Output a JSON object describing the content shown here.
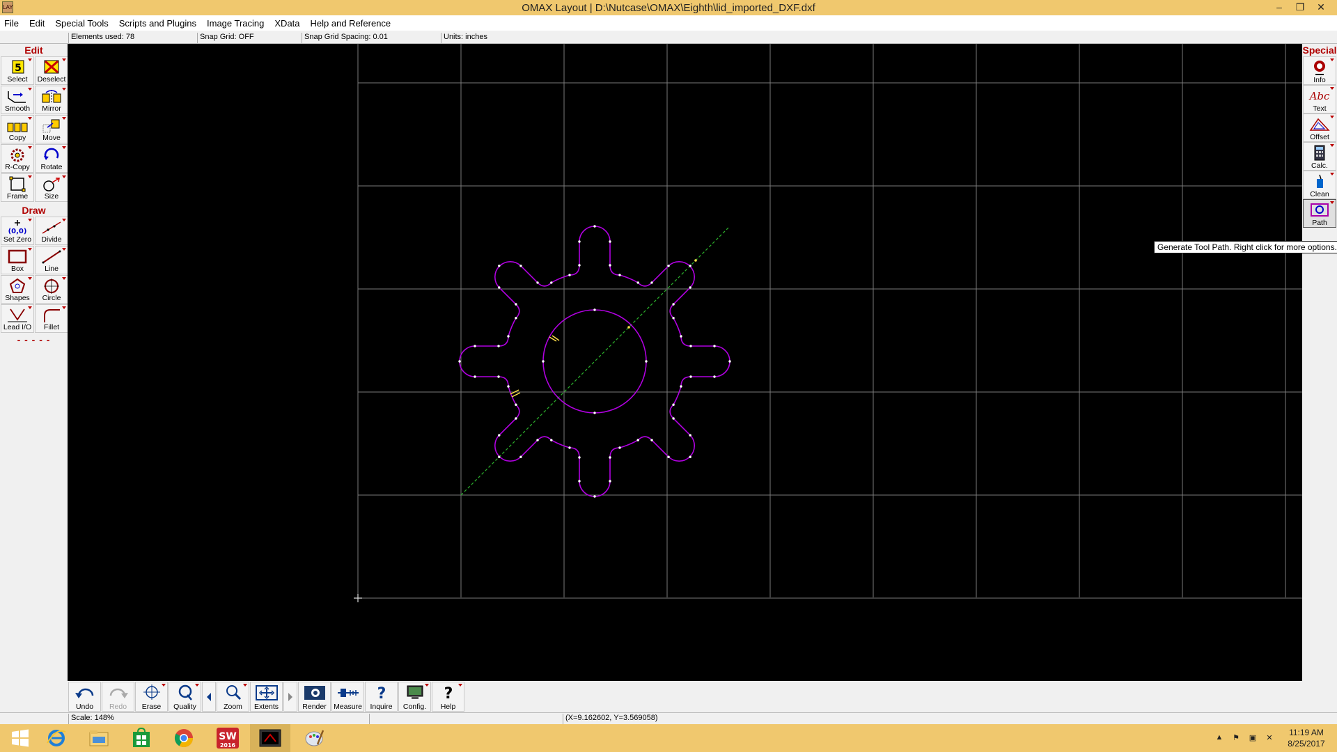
{
  "window": {
    "title": "OMAX Layout | D:\\Nutcase\\OMAX\\Eighth\\lid_imported_DXF.dxf",
    "app_icon_text": "LAY",
    "controls": [
      "–",
      "❐",
      "✕"
    ]
  },
  "menu": [
    "File",
    "Edit",
    "Special Tools",
    "Scripts and Plugins",
    "Image Tracing",
    "XData",
    "Help and Reference"
  ],
  "status_top": {
    "elements_used": "Elements used: 78",
    "snap_grid": "Snap Grid: OFF",
    "snap_spacing": "Snap Grid Spacing: 0.01",
    "units": "Units: inches"
  },
  "left_toolbar": {
    "edit_heading": "Edit",
    "draw_heading": "Draw",
    "more": "- - - - -",
    "edit_tools": [
      {
        "label": "Select",
        "icon": "select-icon"
      },
      {
        "label": "Deselect",
        "icon": "deselect-icon"
      },
      {
        "label": "Smooth",
        "icon": "smooth-icon"
      },
      {
        "label": "Mirror",
        "icon": "mirror-icon"
      },
      {
        "label": "Copy",
        "icon": "copy-icon"
      },
      {
        "label": "Move",
        "icon": "move-icon"
      },
      {
        "label": "R-Copy",
        "icon": "rotary-copy-icon"
      },
      {
        "label": "Rotate",
        "icon": "rotate-icon"
      },
      {
        "label": "Frame",
        "icon": "frame-icon"
      },
      {
        "label": "Size",
        "icon": "size-icon"
      }
    ],
    "draw_tools": [
      {
        "label": "Set Zero",
        "icon": "set-zero-icon"
      },
      {
        "label": "Divide",
        "icon": "divide-icon"
      },
      {
        "label": "Box",
        "icon": "box-icon"
      },
      {
        "label": "Line",
        "icon": "line-icon"
      },
      {
        "label": "Shapes",
        "icon": "shapes-icon"
      },
      {
        "label": "Circle",
        "icon": "circle-icon"
      },
      {
        "label": "Lead I/O",
        "icon": "lead-io-icon"
      },
      {
        "label": "Fillet",
        "icon": "fillet-icon"
      }
    ]
  },
  "right_toolbar": {
    "heading": "Special",
    "tools": [
      {
        "label": "Info",
        "icon": "info-icon"
      },
      {
        "label": "Text",
        "icon": "text-icon",
        "glyph": "Abc"
      },
      {
        "label": "Offset",
        "icon": "offset-icon"
      },
      {
        "label": "Calc.",
        "icon": "calculator-icon"
      },
      {
        "label": "Clean",
        "icon": "clean-icon"
      },
      {
        "label": "Path",
        "icon": "path-icon"
      }
    ]
  },
  "tooltip": "Generate Tool Path. Right click for more options.",
  "bottom_toolbar": [
    {
      "label": "Undo",
      "icon": "undo-icon"
    },
    {
      "label": "Redo",
      "icon": "redo-icon",
      "disabled": true
    },
    {
      "label": "Erase",
      "icon": "erase-icon"
    },
    {
      "label": "Quality",
      "icon": "quality-icon"
    },
    {
      "label": "Zoom",
      "icon": "zoom-icon"
    },
    {
      "label": "Extents",
      "icon": "extents-icon"
    },
    {
      "label": "Render",
      "icon": "render-icon"
    },
    {
      "label": "Measure",
      "icon": "measure-icon"
    },
    {
      "label": "Inquire",
      "icon": "inquire-icon"
    },
    {
      "label": "Config.",
      "icon": "config-icon"
    },
    {
      "label": "Help",
      "icon": "help-icon"
    }
  ],
  "status_bottom": {
    "scale": "Scale: 148%",
    "coords": "(X=9.162602, Y=3.569058)"
  },
  "taskbar": {
    "apps": [
      {
        "name": "start",
        "icon": "windows-start-icon"
      },
      {
        "name": "internet-explorer",
        "icon": "ie-icon"
      },
      {
        "name": "file-explorer",
        "icon": "folder-icon"
      },
      {
        "name": "store",
        "icon": "store-icon"
      },
      {
        "name": "chrome",
        "icon": "chrome-icon"
      },
      {
        "name": "solidworks",
        "icon": "solidworks-icon",
        "badge": "2016"
      },
      {
        "name": "omax-layout",
        "icon": "omax-icon",
        "active": true
      },
      {
        "name": "paint",
        "icon": "paint-icon"
      }
    ],
    "time": "11:19 AM",
    "date": "8/25/2017"
  },
  "colors": {
    "titlebar": "#f0c86e",
    "canvas": "#000000",
    "grid": "#7a7a7a",
    "part": "#b000e0",
    "centerline": "#2aa82a",
    "heading": "#b00000"
  }
}
